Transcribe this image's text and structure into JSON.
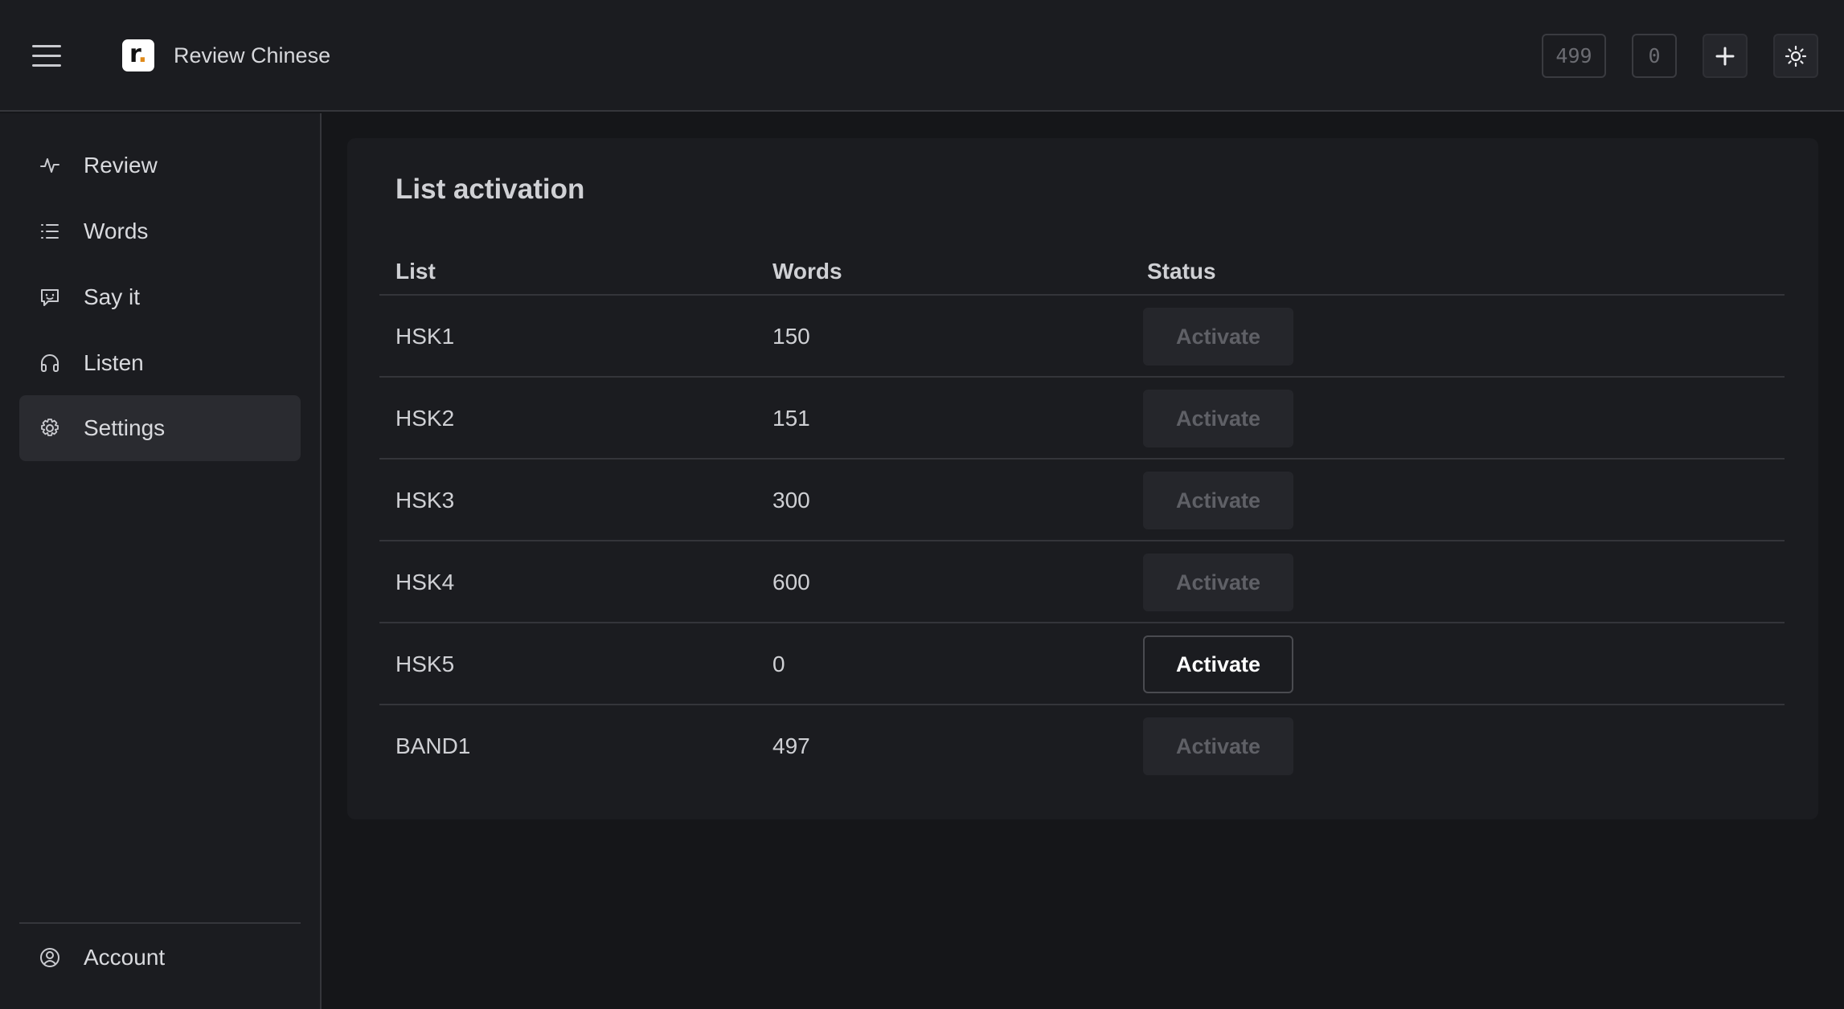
{
  "app": {
    "title": "Review Chinese",
    "logo_letter": "r",
    "logo_dot": "."
  },
  "header": {
    "count_a": "499",
    "count_b": "0",
    "add_label": "+",
    "theme_icon": "sun-icon"
  },
  "sidebar": {
    "items": [
      {
        "label": "Review",
        "icon": "activity-icon"
      },
      {
        "label": "Words",
        "icon": "list-icon"
      },
      {
        "label": "Say it",
        "icon": "message-icon"
      },
      {
        "label": "Listen",
        "icon": "headphones-icon"
      },
      {
        "label": "Settings",
        "icon": "gear-icon",
        "active": true
      }
    ],
    "account": {
      "label": "Account",
      "icon": "user-circle-icon"
    }
  },
  "main": {
    "title": "List activation",
    "columns": [
      "List",
      "Words",
      "Status"
    ],
    "rows": [
      {
        "list": "HSK1",
        "words": "150",
        "button": "Activate",
        "enabled": false
      },
      {
        "list": "HSK2",
        "words": "151",
        "button": "Activate",
        "enabled": false
      },
      {
        "list": "HSK3",
        "words": "300",
        "button": "Activate",
        "enabled": false
      },
      {
        "list": "HSK4",
        "words": "600",
        "button": "Activate",
        "enabled": false
      },
      {
        "list": "HSK5",
        "words": "0",
        "button": "Activate",
        "enabled": true
      },
      {
        "list": "BAND1",
        "words": "497",
        "button": "Activate",
        "enabled": false
      }
    ]
  },
  "colors": {
    "background": "#151619",
    "panel": "#1b1c20",
    "active_item": "#2a2b30",
    "logo_accent": "#e08a1a"
  }
}
